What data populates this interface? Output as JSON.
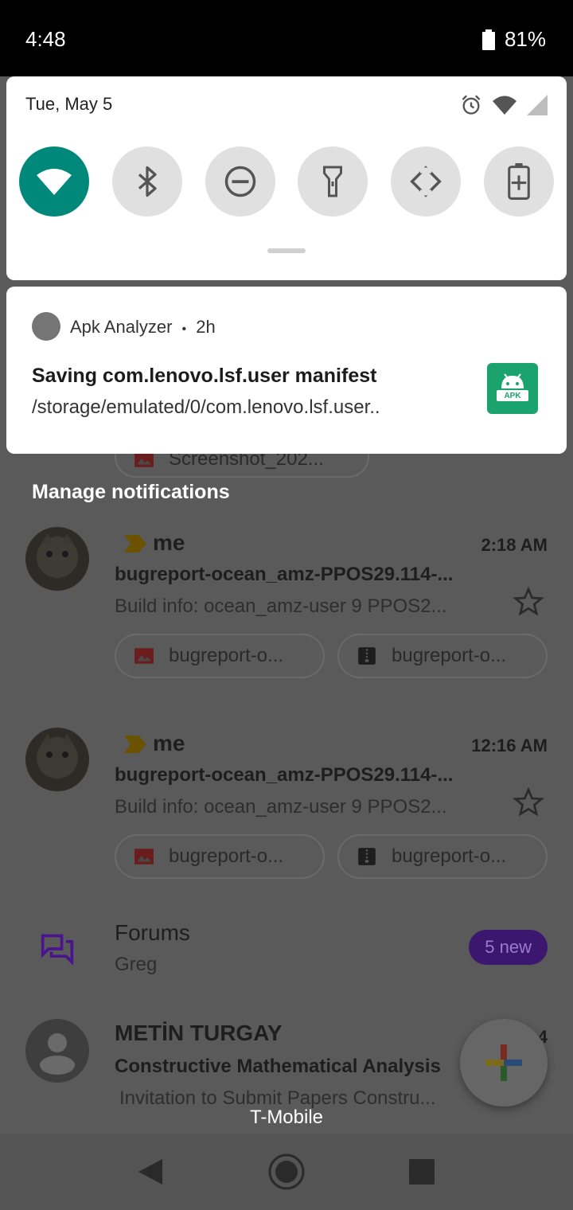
{
  "status_bar": {
    "time": "4:48",
    "battery": "81%"
  },
  "quick_settings": {
    "date": "Tue, May 5",
    "tiles": [
      {
        "name": "wifi",
        "active": true
      },
      {
        "name": "bluetooth",
        "active": false
      },
      {
        "name": "do-not-disturb",
        "active": false
      },
      {
        "name": "flashlight",
        "active": false
      },
      {
        "name": "auto-rotate",
        "active": false
      },
      {
        "name": "battery-saver",
        "active": false
      }
    ]
  },
  "notification": {
    "app_name": "Apk Analyzer",
    "separator": "•",
    "age": "2h",
    "title": "Saving com.lenovo.lsf.user manifest",
    "body": "/storage/emulated/0/com.lenovo.lsf.user..",
    "icon_label": "APK"
  },
  "background": {
    "partial_chip": "Screenshot_202...",
    "manage_label": "Manage notifications",
    "emails": [
      {
        "sender": "me",
        "time": "2:18 AM",
        "subject": "bugreport-ocean_amz-PPOS29.114-...",
        "snippet": "Build info: ocean_amz-user 9 PPOS2...",
        "chips": [
          "bugreport-o...",
          "bugreport-o..."
        ]
      },
      {
        "sender": "me",
        "time": "12:16 AM",
        "subject": "bugreport-ocean_amz-PPOS29.114-...",
        "snippet": "Build info: ocean_amz-user 9 PPOS2...",
        "chips": [
          "bugreport-o...",
          "bugreport-o..."
        ]
      }
    ],
    "forums": {
      "title": "Forums",
      "subtitle": "Greg",
      "badge": "5 new"
    },
    "last_email": {
      "sender": "METİN TURGAY",
      "time": "4",
      "subject": "Constructive Mathematical Analysis",
      "snippet": "Invitation to Submit Papers Constru..."
    }
  },
  "carrier": "T-Mobile",
  "colors": {
    "accent_tile": "#00897b",
    "apk_icon": "#1aa36c",
    "forums_icon": "#4a148c"
  }
}
